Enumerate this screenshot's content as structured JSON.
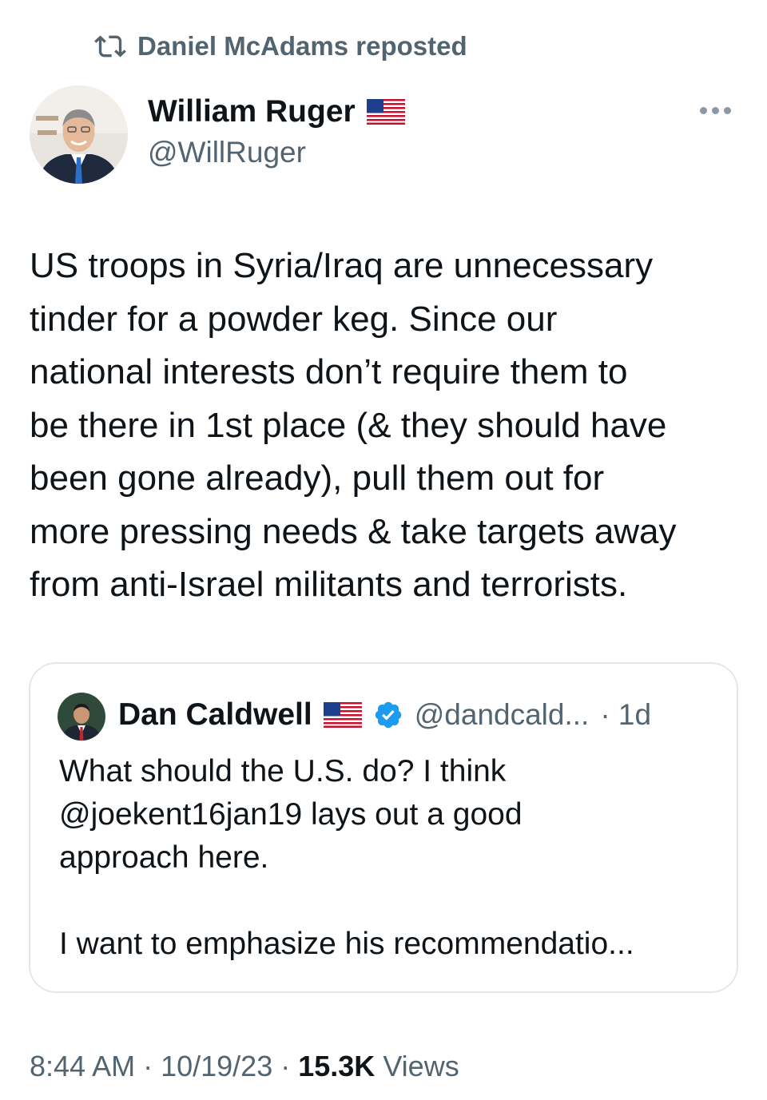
{
  "repost": {
    "label": "Daniel McAdams reposted"
  },
  "author": {
    "name": "William Ruger",
    "handle": "@WillRuger",
    "flag_icon": "us-flag-icon"
  },
  "tweet": {
    "lines": [
      "US troops in Syria/Iraq are unnecessary",
      "tinder for a powder keg.  Since our",
      "national interests don’t require them to",
      "be there in 1st place (& they should have",
      "been gone already), pull them out for",
      "more pressing needs & take targets away",
      "from anti-Israel militants and terrorists."
    ]
  },
  "quote": {
    "name": "Dan Caldwell",
    "handle": "@dandcald...",
    "age": "· 1d",
    "verified_color": "#1d9bf0",
    "lines": [
      "What should the U.S. do? I think",
      "@joekent16jan19 lays out a good",
      "approach here.",
      "",
      "I want to emphasize his recommendatio..."
    ]
  },
  "meta": {
    "time": "8:44 AM",
    "sep1": " · ",
    "date": "10/19/23",
    "sep2": " · ",
    "views_count": "15.3K",
    "views_label": " Views"
  },
  "colors": {
    "text": "#0f1419",
    "secondary": "#536471",
    "border": "#e1e8ed"
  }
}
